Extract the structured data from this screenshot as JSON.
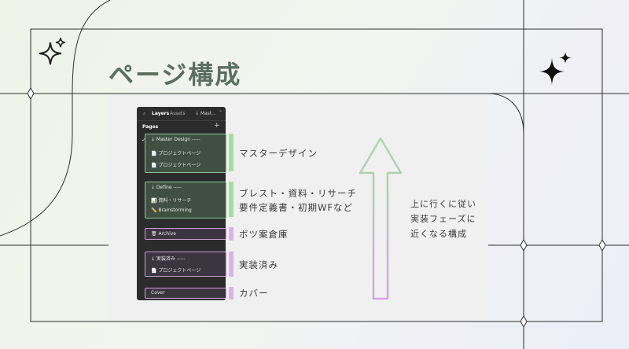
{
  "slide": {
    "title": "ページ構成",
    "figma_panel": {
      "tabs": {
        "search_icon": "search-icon",
        "layers": "Layers",
        "assets": "Assets",
        "master": "↓ Mast...",
        "chevron": "⌃"
      },
      "pages_header": "Pages",
      "add_icon": "+",
      "check_icon": "✓",
      "pages": [
        "↓ Master Design -----",
        "📄 プロジェクトページ",
        "📄 プロジェクトページ",
        "↓ Define -----",
        "📊 資料・リサーチ",
        "✏️ Brainstorming",
        "🗑 Archive",
        "↓ 実装済み -----",
        "📄 プロジェクトページ",
        "Cover"
      ]
    },
    "labels": {
      "master": "マスターデザイン",
      "define_line1": "ブレスト・資料・リサーチ",
      "define_line2": "要件定義書・初期WFなど",
      "archive": "ボツ案倉庫",
      "implemented": "実装済み",
      "cover": "カバー"
    },
    "description": [
      "上に行くに従い",
      "実装フェーズに",
      "近くなる構成"
    ],
    "colors": {
      "title": "#5c6f5f",
      "green": "#a8dca6",
      "purple": "#d9b4e4"
    }
  }
}
